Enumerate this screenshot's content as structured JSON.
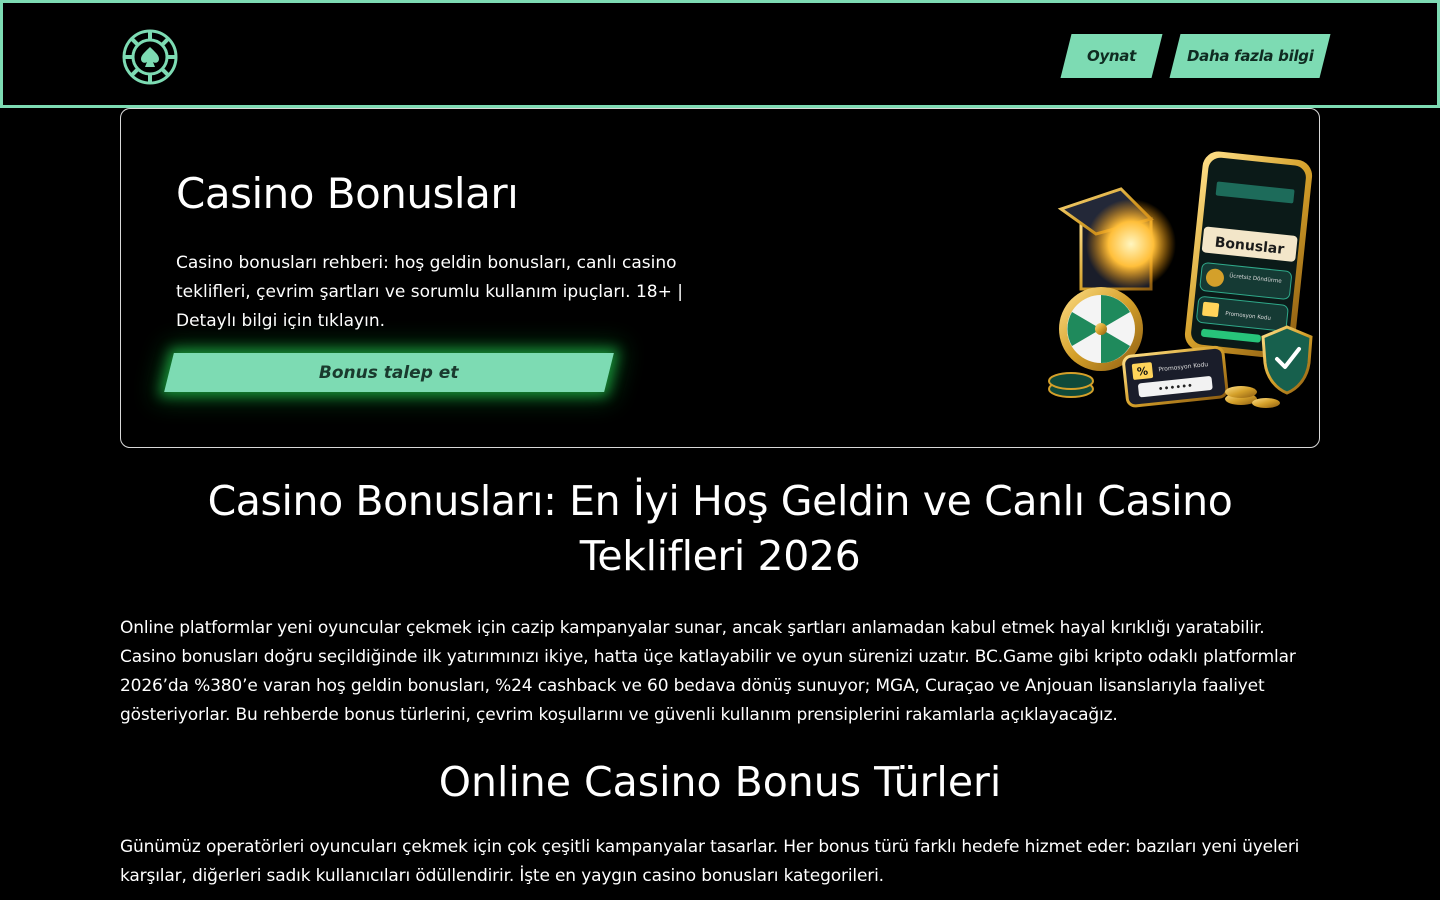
{
  "header": {
    "logo_icon": "casino-chip-spade-icon",
    "buttons": {
      "play_label": "Oynat",
      "more_label": "Daha fazla bilgi"
    }
  },
  "hero": {
    "title": "Casino Bonusları",
    "description": "Casino bonusları rehberi: hoş geldin bonusları, canlı casino teklifleri, çevrim şartları ve sorumlu kullanım ipuçları. 18+ | Detaylı bilgi için tıklayın.",
    "cta_label": "Bonus talep et",
    "illustration": {
      "phone_title": "Bonuslar",
      "row1": "Ücretsiz Döndürme",
      "row2": "Promosyon Kodu",
      "ticket_label": "Promosyon Kodu",
      "ticket_code": "••••••",
      "percent": "%"
    }
  },
  "article": {
    "heading1": "Casino Bonusları: En İyi Hoş Geldin ve Canlı Casino Teklifleri 2026",
    "paragraph1": "Online platformlar yeni oyuncular çekmek için cazip kampanyalar sunar, ancak şartları anlamadan kabul etmek hayal kırıklığı yaratabilir. Casino bonusları doğru seçildiğinde ilk yatırımınızı ikiye, hatta üçe katlayabilir ve oyun sürenizi uzatır. BC.Game gibi kripto odaklı platformlar 2026’da %380’e varan hoş geldin bonusları, %24 cashback ve 60 bedava dönüş sunuyor; MGA, Curaçao ve Anjouan lisanslarıyla faaliyet gösteriyorlar. Bu rehberde bonus türlerini, çevrim koşullarını ve güvenli kullanım prensiplerini rakamlarla açıklayacağız.",
    "heading2": "Online Casino Bonus Türleri",
    "paragraph2": "Günümüz operatörleri oyuncuları çekmek için çok çeşitli kampanyalar tasarlar. Her bonus türü farklı hedefe hizmet eder: bazıları yeni üyeleri karşılar, diğerleri sadık kullanıcıları ödüllendirir. İşte en yaygın casino bonusları kategorileri."
  },
  "colors": {
    "accent": "#7ddbb3",
    "background": "#000000",
    "glow": "#28dc5a"
  }
}
